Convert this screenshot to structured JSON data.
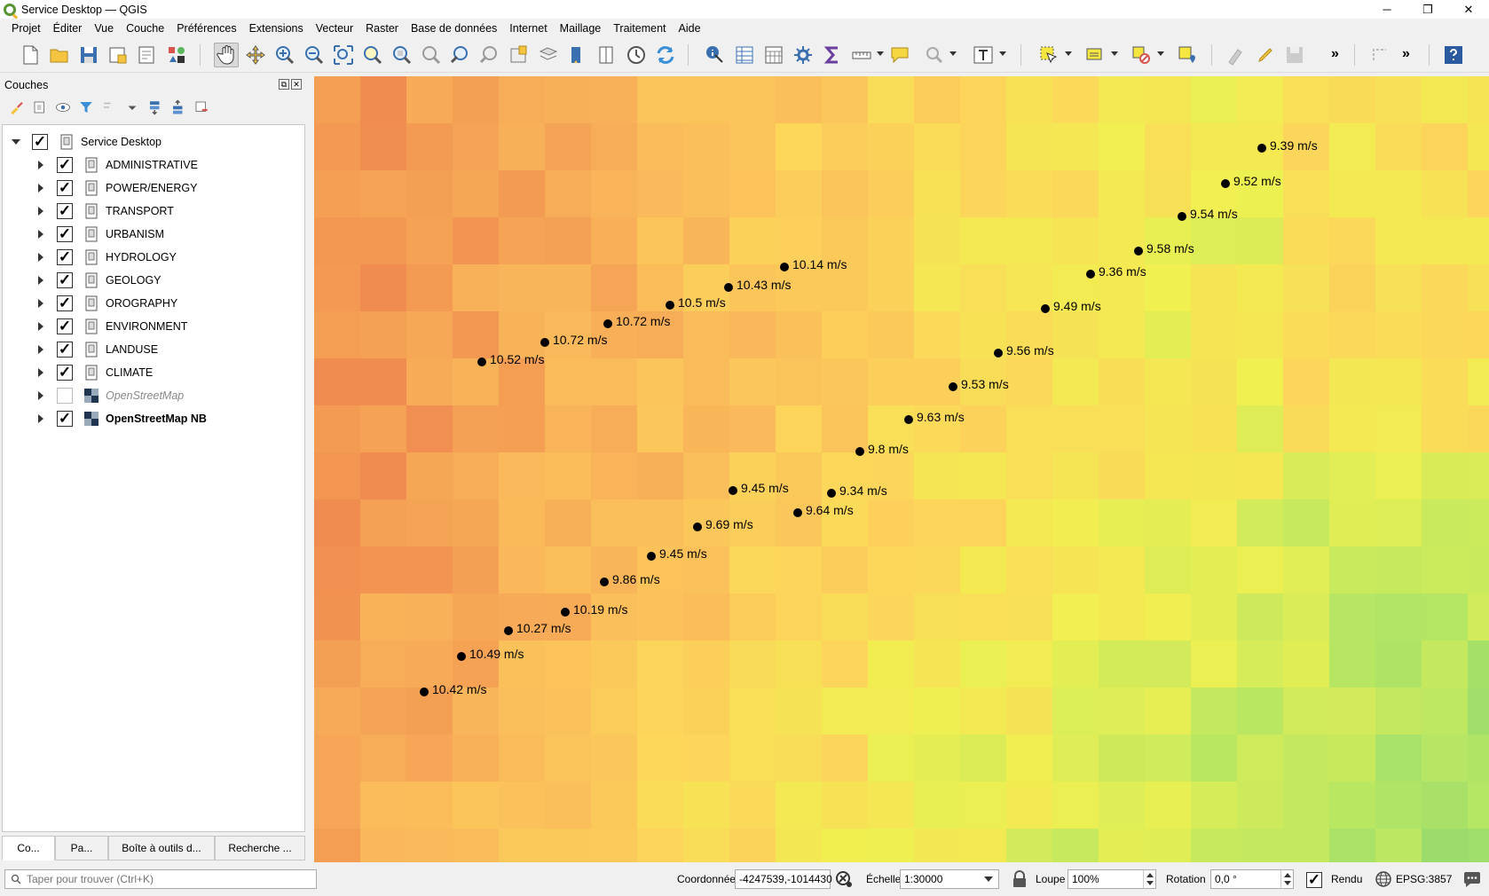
{
  "window": {
    "title": "Service Desktop — QGIS",
    "controls": [
      "─",
      "❐",
      "✕"
    ]
  },
  "menu": [
    "Projet",
    "Éditer",
    "Vue",
    "Couche",
    "Préférences",
    "Extensions",
    "Vecteur",
    "Raster",
    "Base de données",
    "Internet",
    "Maillage",
    "Traitement",
    "Aide"
  ],
  "toolbar": {
    "more": "»"
  },
  "layers_panel": {
    "title": "Couches",
    "root": "Service Desktop",
    "layers": [
      {
        "name": "ADMINISTRATIVE",
        "checked": true,
        "kind": "group"
      },
      {
        "name": "POWER/ENERGY",
        "checked": true,
        "kind": "group"
      },
      {
        "name": "TRANSPORT",
        "checked": true,
        "kind": "group"
      },
      {
        "name": "URBANISM",
        "checked": true,
        "kind": "group"
      },
      {
        "name": "HYDROLOGY",
        "checked": true,
        "kind": "group"
      },
      {
        "name": "GEOLOGY",
        "checked": true,
        "kind": "group"
      },
      {
        "name": "OROGRAPHY",
        "checked": true,
        "kind": "group"
      },
      {
        "name": "ENVIRONMENT",
        "checked": true,
        "kind": "group"
      },
      {
        "name": "LANDUSE",
        "checked": true,
        "kind": "group"
      },
      {
        "name": "CLIMATE",
        "checked": true,
        "kind": "group"
      },
      {
        "name": "OpenStreetMap",
        "checked": false,
        "kind": "tiles"
      },
      {
        "name": "OpenStreetMap NB",
        "checked": true,
        "kind": "tiles"
      }
    ],
    "tabs": [
      "Co...",
      "Pa...",
      "Boîte à outils d...",
      "Recherche ..."
    ]
  },
  "map": {
    "points": [
      {
        "label": "9.39 m/s"
      },
      {
        "label": "9.52 m/s"
      },
      {
        "label": "9.54 m/s"
      },
      {
        "label": "9.58 m/s"
      },
      {
        "label": "9.36 m/s"
      },
      {
        "label": "9.49 m/s"
      },
      {
        "label": "9.56 m/s"
      },
      {
        "label": "9.53 m/s"
      },
      {
        "label": "9.63 m/s"
      },
      {
        "label": "9.8 m/s"
      },
      {
        "label": "9.34 m/s"
      },
      {
        "label": "9.64 m/s"
      },
      {
        "label": "10.14 m/s"
      },
      {
        "label": "10.43 m/s"
      },
      {
        "label": "10.5 m/s"
      },
      {
        "label": "10.72 m/s"
      },
      {
        "label": "10.72 m/s"
      },
      {
        "label": "10.52 m/s"
      },
      {
        "label": "9.45 m/s"
      },
      {
        "label": "9.69 m/s"
      },
      {
        "label": "9.45 m/s"
      },
      {
        "label": "9.86 m/s"
      },
      {
        "label": "10.19 m/s"
      },
      {
        "label": "10.27 m/s"
      },
      {
        "label": "10.49 m/s"
      },
      {
        "label": "10.42 m/s"
      }
    ]
  },
  "statusbar": {
    "search_placeholder": "Taper pour trouver (Ctrl+K)",
    "coord_label": "Coordonnée",
    "coord_value": "-4247539,-1014430",
    "scale_label": "Échelle",
    "scale_value": "1:30000",
    "magnifier_label": "Loupe",
    "magnifier_value": "100%",
    "rotation_label": "Rotation",
    "rotation_value": "0,0 °",
    "render_label": "Rendu",
    "render_checked": true,
    "crs": "EPSG:3857"
  }
}
